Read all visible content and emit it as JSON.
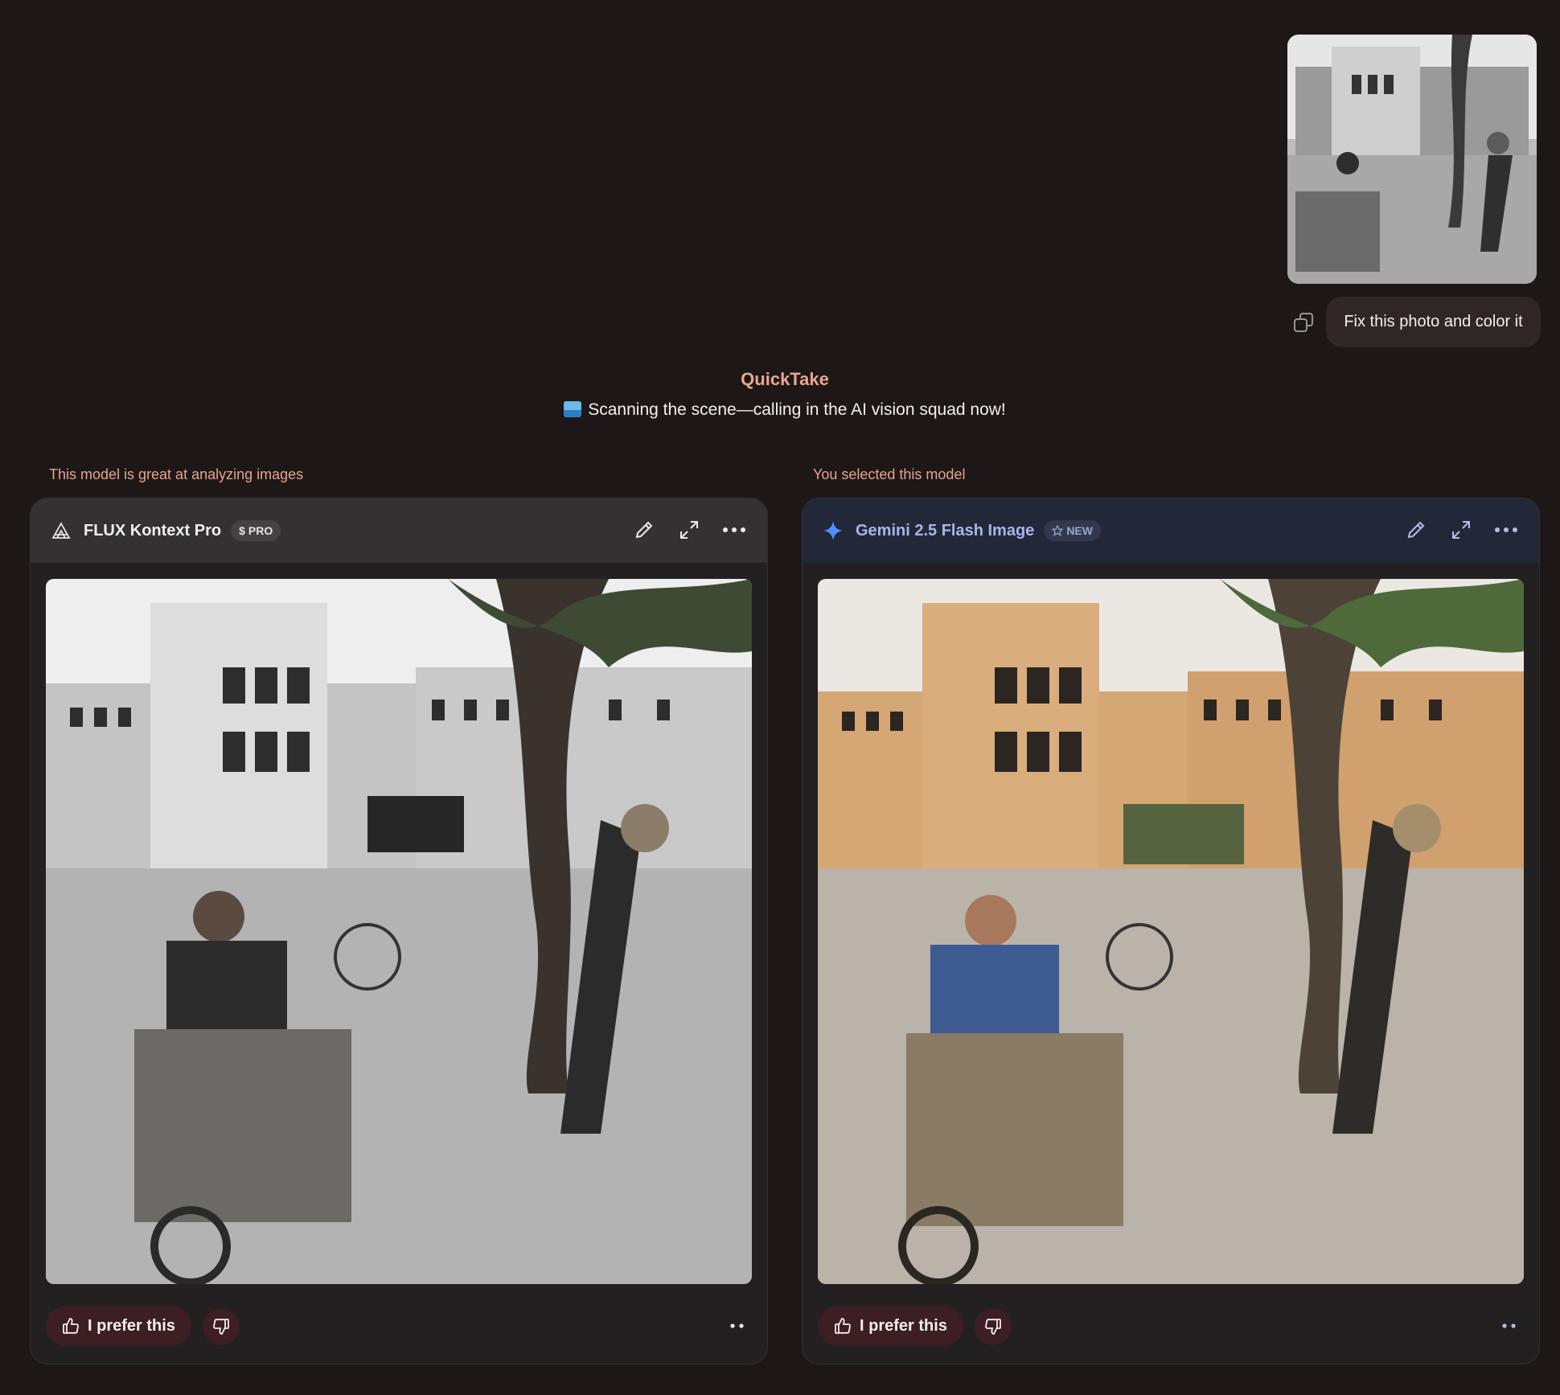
{
  "user_message": {
    "image_icon": "user-uploaded-photo-bw",
    "text": "Fix this photo and color it",
    "copy_icon": "copy-icon"
  },
  "quicktake": {
    "title": "QuickTake",
    "emoji_icon": "image-landscape-emoji",
    "text": "Scanning the scene—calling in the AI vision squad now!"
  },
  "cards": [
    {
      "note": "This model is great at analyzing images",
      "model_name": "FLUX Kontext Pro",
      "model_icon": "flux-triangle-icon",
      "badge_icon": "dollar-icon",
      "badge": "PRO",
      "image_icon": "result-image-flux",
      "prefer_label": "I prefer this"
    },
    {
      "note": "You selected this model",
      "model_name": "Gemini 2.5 Flash Image",
      "model_icon": "gemini-sparkle-icon",
      "badge_icon": "star-icon",
      "badge": "NEW",
      "image_icon": "result-image-gemini",
      "prefer_label": "I prefer this"
    }
  ],
  "colors": {
    "background": "#1e1718",
    "accent": "#e9a88d",
    "gemini_name": "#a9b4ea",
    "prefer_button": "#3c1e23"
  }
}
